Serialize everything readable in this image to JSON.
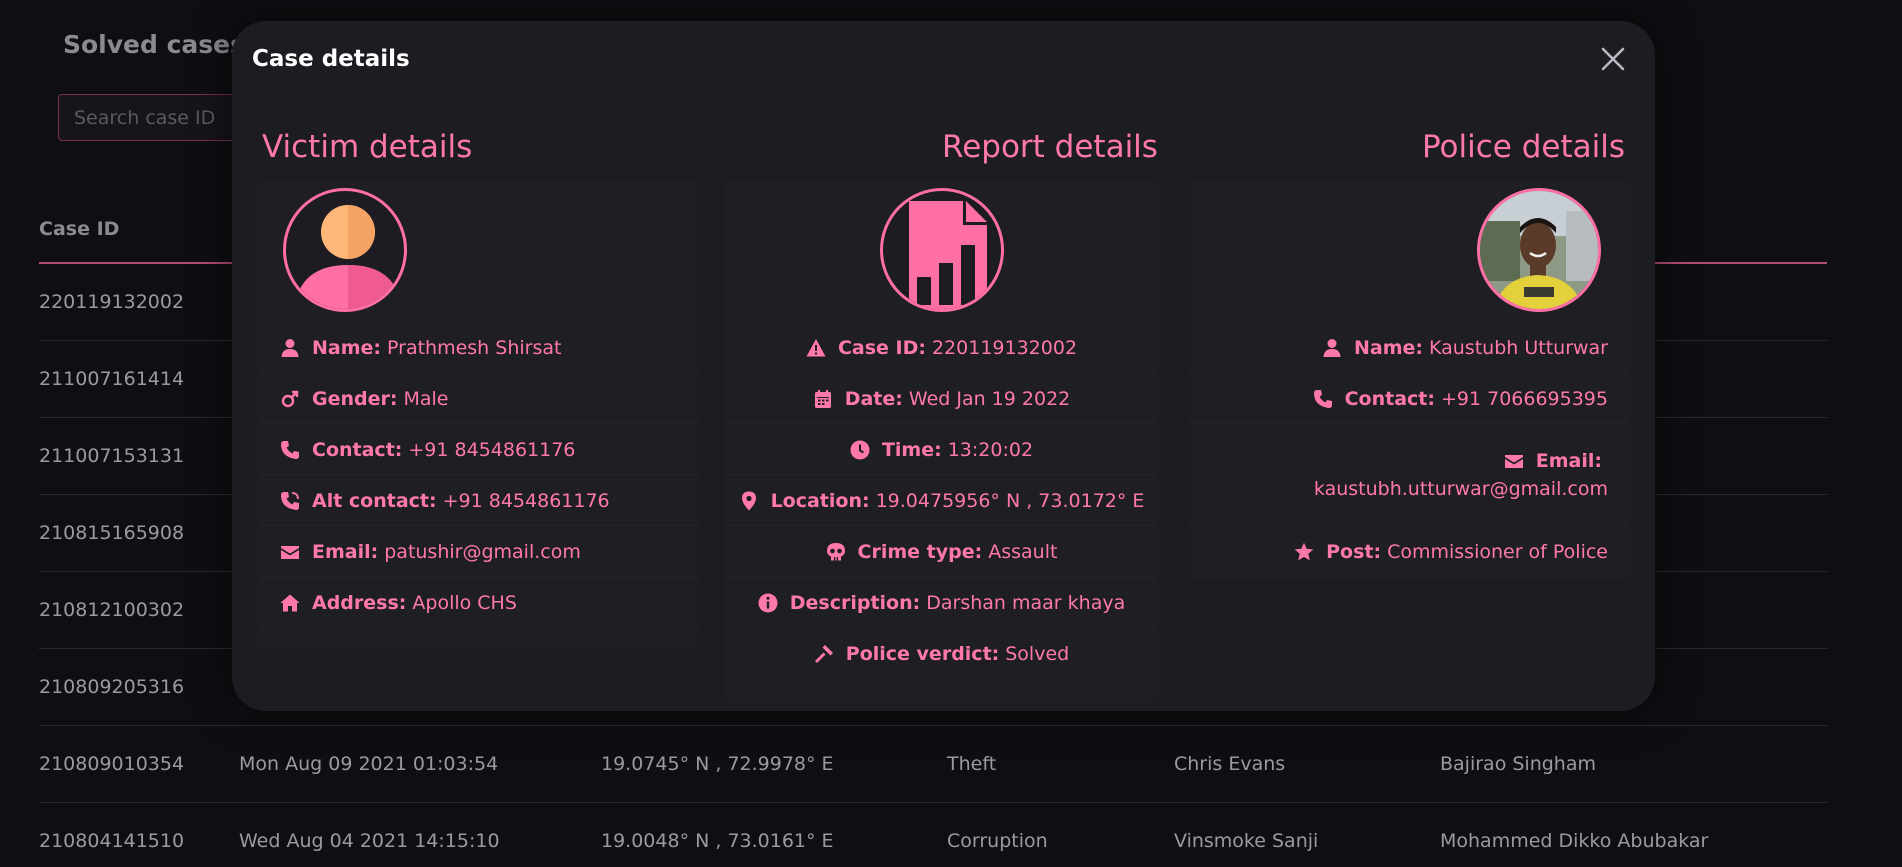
{
  "background": {
    "title": "Solved cases",
    "search_placeholder": "Search case ID",
    "header": [
      "Case ID"
    ],
    "rows": [
      [
        "220119132002",
        "",
        "",
        "",
        "",
        ""
      ],
      [
        "211007161414",
        "",
        "",
        "",
        "",
        ""
      ],
      [
        "211007153131",
        "",
        "",
        "",
        "",
        ""
      ],
      [
        "210815165908",
        "",
        "",
        "",
        "",
        ""
      ],
      [
        "210812100302",
        "",
        "",
        "",
        "",
        ""
      ],
      [
        "210809205316",
        "",
        "",
        "",
        "",
        ""
      ],
      [
        "210809010354",
        "Mon Aug 09 2021 01:03:54",
        "19.0745° N , 72.9978° E",
        "Theft",
        "Chris Evans",
        "Bajirao Singham"
      ],
      [
        "210804141510",
        "Wed Aug 04 2021 14:15:10",
        "19.0048° N , 73.0161° E",
        "Corruption",
        "Vinsmoke Sanji",
        "Mohammed Dikko Abubakar"
      ]
    ]
  },
  "modal": {
    "title": "Case details",
    "close_icon": "close-icon",
    "victim": {
      "heading": "Victim details",
      "avatar_icon": "person-avatar-icon",
      "fields": [
        {
          "icon": "user-icon",
          "label": "Name:",
          "value": "Prathmesh Shirsat"
        },
        {
          "icon": "mars-icon",
          "label": "Gender:",
          "value": "Male"
        },
        {
          "icon": "phone-icon",
          "label": "Contact:",
          "value": "+91 8454861176"
        },
        {
          "icon": "phone-volume-icon",
          "label": "Alt contact:",
          "value": "+91 8454861176"
        },
        {
          "icon": "envelope-icon",
          "label": "Email:",
          "value": "patushir@gmail.com"
        },
        {
          "icon": "home-icon",
          "label": "Address:",
          "value": "Apollo CHS"
        }
      ]
    },
    "report": {
      "heading": "Report details",
      "avatar_icon": "report-file-icon",
      "fields": [
        {
          "icon": "warning-icon",
          "label": "Case ID:",
          "value": "220119132002"
        },
        {
          "icon": "calendar-icon",
          "label": "Date:",
          "value": "Wed Jan 19 2022"
        },
        {
          "icon": "clock-icon",
          "label": "Time:",
          "value": "13:20:02"
        },
        {
          "icon": "location-pin-icon",
          "label": "Location:",
          "value": "19.0475956° N , 73.0172° E"
        },
        {
          "icon": "skull-icon",
          "label": "Crime type:",
          "value": "Assault"
        },
        {
          "icon": "info-icon",
          "label": "Description:",
          "value": "Darshan maar khaya"
        },
        {
          "icon": "gavel-icon",
          "label": "Police verdict:",
          "value": "Solved"
        }
      ]
    },
    "police": {
      "heading": "Police details",
      "avatar_icon": "officer-photo",
      "fields": [
        {
          "icon": "user-icon",
          "label": "Name:",
          "value": "Kaustubh Utturwar"
        },
        {
          "icon": "phone-icon",
          "label": "Contact:",
          "value": "+91 7066695395"
        },
        {
          "icon": "envelope-icon",
          "label": "Email:",
          "value": "kaustubh.utturwar@gmail.com"
        },
        {
          "icon": "star-icon",
          "label": "Post:",
          "value": "Commissioner of Police"
        }
      ]
    }
  },
  "colors": {
    "accent": "#ff79a8",
    "modal_bg": "#1c1c22",
    "page_bg": "#0f0f13"
  }
}
